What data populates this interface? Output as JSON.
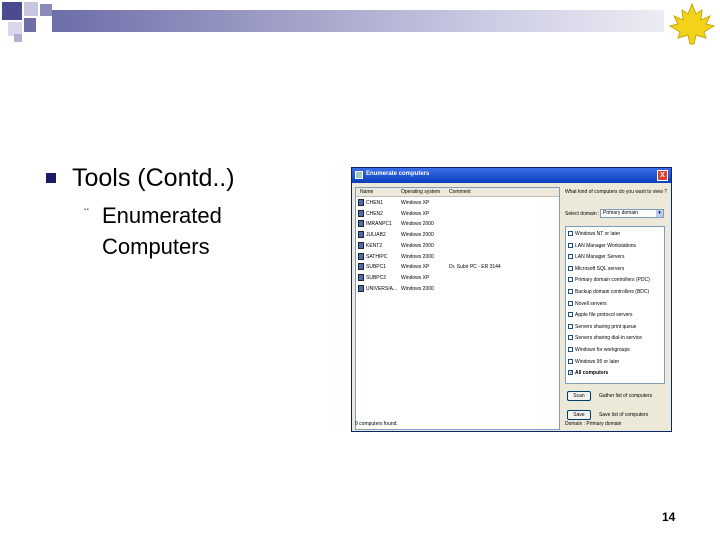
{
  "slide": {
    "title": "Tools (Contd..)",
    "subtitle": "Enumerated Computers",
    "sub_bullet": "¨",
    "page_number": "14"
  },
  "dialog": {
    "title": "Enumerate computers",
    "close_label": "X",
    "columns": [
      "Name",
      "Operating system",
      "Comment"
    ],
    "rows": [
      {
        "name": "CHEN1",
        "os": "Windows XP",
        "comment": ""
      },
      {
        "name": "CHEN2",
        "os": "Windows XP",
        "comment": ""
      },
      {
        "name": "IMRANPC1",
        "os": "Windows 2000",
        "comment": ""
      },
      {
        "name": "JULIAB2",
        "os": "Windows 2000",
        "comment": ""
      },
      {
        "name": "KENT2",
        "os": "Windows 2000",
        "comment": ""
      },
      {
        "name": "SATHIPC",
        "os": "Windows 2000",
        "comment": ""
      },
      {
        "name": "SUBPC1",
        "os": "Windows XP",
        "comment": "Dr. Subir PC - ER 3144"
      },
      {
        "name": "SUBPC2",
        "os": "Windows XP",
        "comment": ""
      },
      {
        "name": "UNIVERSIA...",
        "os": "Windows 2000",
        "comment": ""
      }
    ],
    "status_left": "9 computers found.",
    "question": "What kind of computers do you want to view ?",
    "select_label": "Select domain :",
    "select_value": "Primary domain",
    "checkboxes": [
      {
        "label": "Windows NT or later",
        "checked": false
      },
      {
        "label": "LAN Manager Workstations",
        "checked": false
      },
      {
        "label": "LAN Manager Servers",
        "checked": false
      },
      {
        "label": "Microsoft SQL servers",
        "checked": false
      },
      {
        "label": "Primary domain controllers (PDC)",
        "checked": false
      },
      {
        "label": "Backup domain controllers (BDC)",
        "checked": false
      },
      {
        "label": "Novell servers",
        "checked": false
      },
      {
        "label": "Apple file protocol servers",
        "checked": false
      },
      {
        "label": "Servers sharing print queue",
        "checked": false
      },
      {
        "label": "Servers sharing dial-in service",
        "checked": false
      },
      {
        "label": "Windows for workgroups",
        "checked": false
      },
      {
        "label": "Windows 95 or later",
        "checked": false
      },
      {
        "label": "All computers",
        "checked": true
      }
    ],
    "scan_label": "Scan",
    "scan_desc": "Gather list of computers",
    "save_label": "Save",
    "save_desc": "Save list of computers",
    "status_right": "Domain : Primary domain"
  },
  "colors": {
    "accent": "#1a1a66",
    "titlebar": "#0a3fbd",
    "logo": "#f2d21b"
  }
}
